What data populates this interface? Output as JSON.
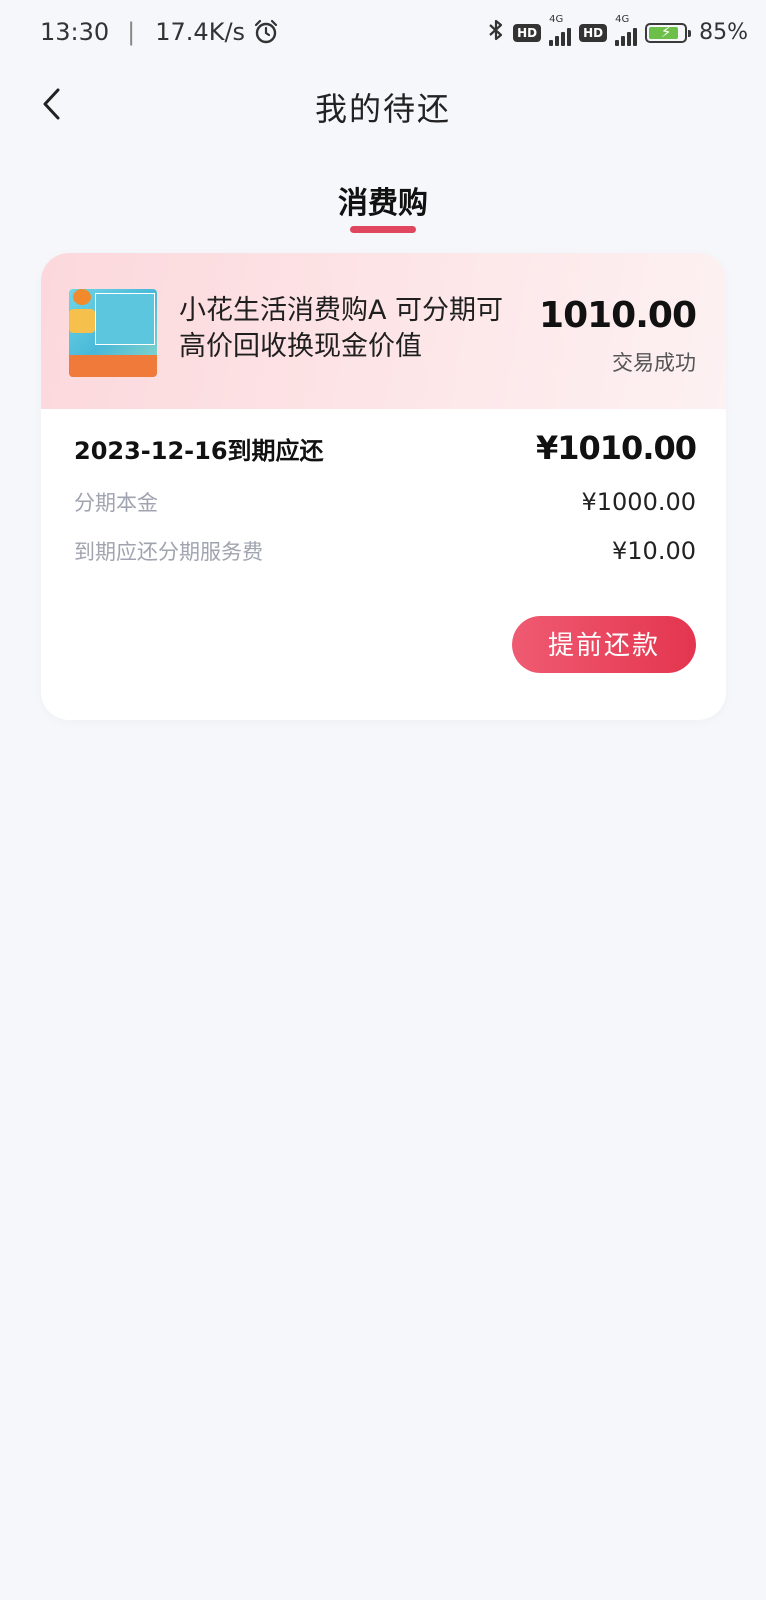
{
  "status_bar": {
    "time": "13:30",
    "separator": "|",
    "net_speed": "17.4K/s",
    "network_type_1": "4G",
    "network_type_2": "4G",
    "hd_label": "HD",
    "battery_percent": "85%",
    "battery_level": 0.85
  },
  "header": {
    "title": "我的待还"
  },
  "tabs": [
    {
      "label": "消费购",
      "active": true
    }
  ],
  "card": {
    "product_name": "小花生活消费购A 可分期可高价回收换现金价值",
    "amount": "1010.00",
    "status": "交易成功",
    "due_label": "2023-12-16到期应还",
    "due_amount": "¥1010.00",
    "principal_label": "分期本金",
    "principal_amount": "¥1000.00",
    "fee_label": "到期应还分期服务费",
    "fee_amount": "¥10.00",
    "repay_button_label": "提前还款"
  },
  "colors": {
    "accent": "#e0465d",
    "button_gradient_start": "#ef5b72",
    "button_gradient_end": "#e4354f",
    "card_header_bg": "#fcd8dc",
    "page_bg": "#f6f7fb",
    "muted_text": "#a0a4b0"
  },
  "icons": {
    "back": "chevron-left-icon",
    "alarm": "alarm-clock-icon",
    "bluetooth": "bluetooth-icon",
    "battery": "battery-charging-icon"
  }
}
